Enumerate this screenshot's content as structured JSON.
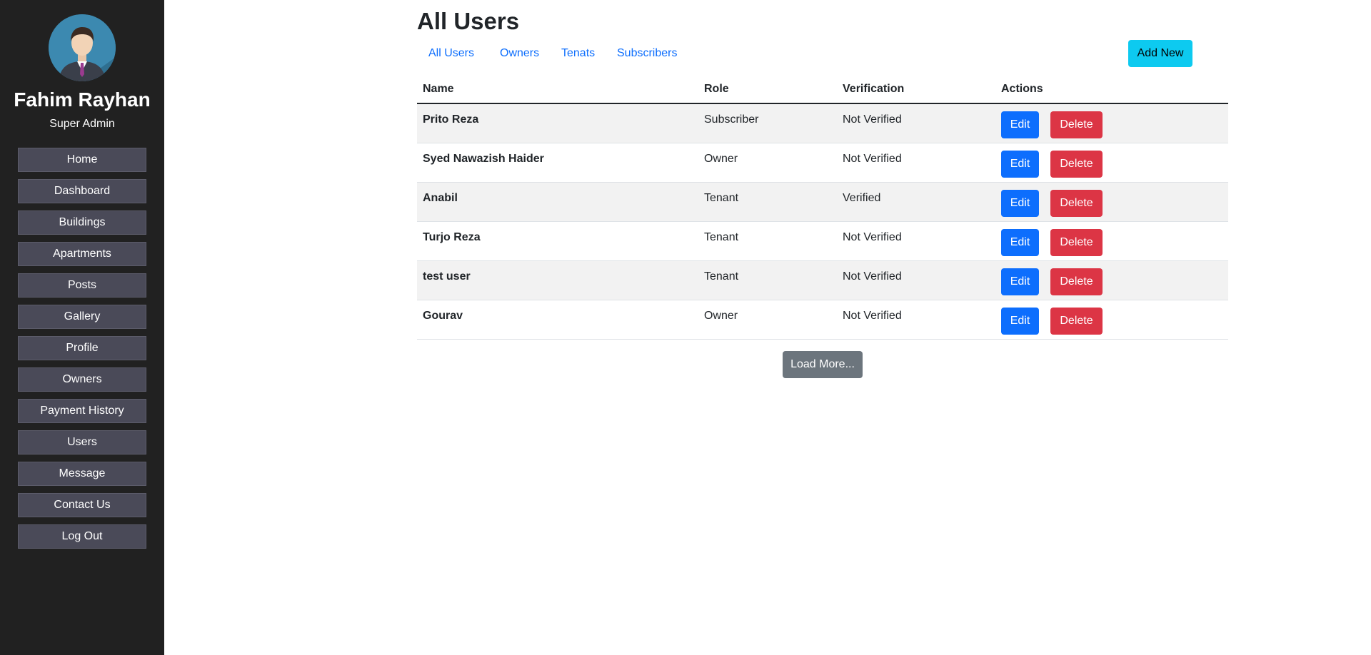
{
  "sidebar": {
    "avatar_icon": "user-avatar-icon",
    "user_name": "Fahim Rayhan",
    "user_role": "Super Admin",
    "nav": [
      {
        "label": "Home"
      },
      {
        "label": "Dashboard"
      },
      {
        "label": "Buildings"
      },
      {
        "label": "Apartments"
      },
      {
        "label": "Posts"
      },
      {
        "label": "Gallery"
      },
      {
        "label": "Profile"
      },
      {
        "label": "Owners"
      },
      {
        "label": "Payment History"
      },
      {
        "label": "Users"
      },
      {
        "label": "Message"
      },
      {
        "label": "Contact Us"
      },
      {
        "label": "Log Out"
      }
    ]
  },
  "main": {
    "title": "All Users",
    "tabs": [
      "All Users",
      "Owners",
      "Tenats",
      "Subscribers"
    ],
    "add_new_label": "Add New",
    "table": {
      "headers": [
        "Name",
        "Role",
        "Verification",
        "Actions"
      ],
      "rows": [
        {
          "name": "Prito Reza",
          "role": "Subscriber",
          "verification": "Not Verified"
        },
        {
          "name": "Syed Nawazish Haider",
          "role": "Owner",
          "verification": "Not Verified"
        },
        {
          "name": "Anabil",
          "role": "Tenant",
          "verification": "Verified"
        },
        {
          "name": "Turjo Reza",
          "role": "Tenant",
          "verification": "Not Verified"
        },
        {
          "name": "test user",
          "role": "Tenant",
          "verification": "Not Verified"
        },
        {
          "name": "Gourav",
          "role": "Owner",
          "verification": "Not Verified"
        }
      ],
      "edit_label": "Edit",
      "delete_label": "Delete"
    },
    "load_more_label": "Load More..."
  },
  "colors": {
    "sidebar_bg": "#212121",
    "nav_item_bg": "#4a4a58",
    "link": "#0d6efd",
    "add_new": "#0dcaf0",
    "edit": "#0d6efd",
    "delete": "#dc3545",
    "load_more": "#6c757d"
  }
}
